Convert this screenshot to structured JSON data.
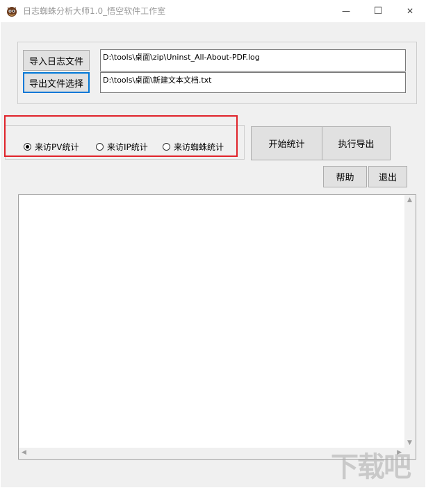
{
  "window": {
    "title": "日志蜘蛛分析大师1.0_悟空软件工作室",
    "minimize_glyph": "—",
    "maximize_glyph": "☐",
    "close_glyph": "✕"
  },
  "file_group": {
    "import_label": "导入日志文件",
    "export_select_label": "导出文件选择",
    "log_path": "D:\\tools\\桌面\\zip\\Uninst_All-About-PDF.log",
    "export_path": "D:\\tools\\桌面\\新建文本文档.txt"
  },
  "stat_options": {
    "items": [
      {
        "label": "来访PV统计",
        "selected": true
      },
      {
        "label": "来访IP统计",
        "selected": false
      },
      {
        "label": "来访蜘蛛统计",
        "selected": false
      }
    ]
  },
  "actions": {
    "start_label": "开始统计",
    "export_label": "执行导出",
    "help_label": "帮助",
    "exit_label": "退出"
  },
  "output": {
    "text": ""
  },
  "watermark": "下载吧",
  "colors": {
    "highlight_box": "#e0232a",
    "focus_border": "#0078d7"
  }
}
